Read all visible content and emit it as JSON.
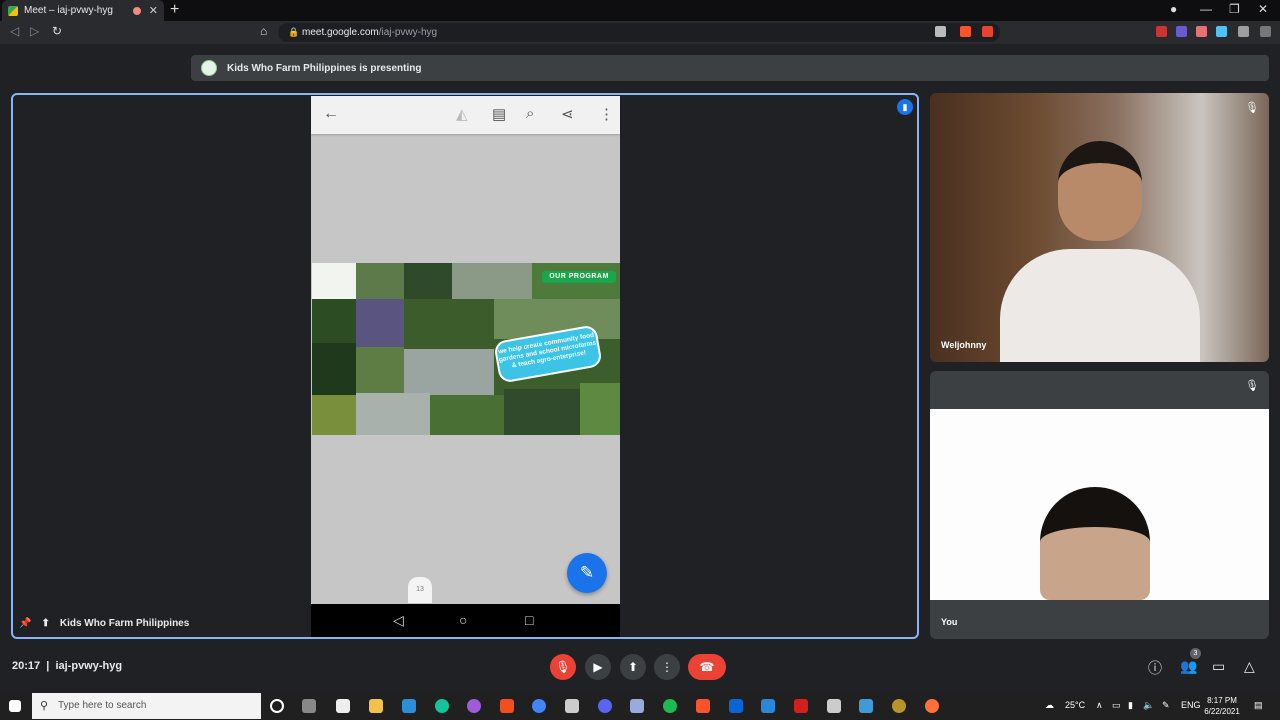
{
  "browser": {
    "tab_title": "Meet – iaj-pvwy-hyg",
    "new_tab": "+",
    "url_host": "meet.google.com",
    "url_path": "/iaj-pvwy-hyg"
  },
  "meet": {
    "presenting_banner": "Kids Who Farm Philippines is presenting",
    "main_tile_name": "Kids Who Farm Philippines",
    "participant1_name": "Weljohnny",
    "participant2_name": "You",
    "time": "20:17",
    "meeting_code": "iaj-pvwy-hyg",
    "people_count": "3"
  },
  "shared_content": {
    "our_program_label": "OUR PROGRAM",
    "bubble_text": "we help create community food gardens and school microfarms & teach agro-enterprise!",
    "page_number": "13"
  },
  "taskbar": {
    "search_placeholder": "Type here to search",
    "temperature": "25°C",
    "language": "ENG",
    "time": "8:17 PM",
    "date": "6/22/2021"
  },
  "colors": {
    "accent_blue": "#8ab4f8",
    "hangup_red": "#ea4335",
    "fab_blue": "#1a73e8",
    "program_green": "#1aa64a",
    "bubble_cyan": "#3cc4e6"
  }
}
